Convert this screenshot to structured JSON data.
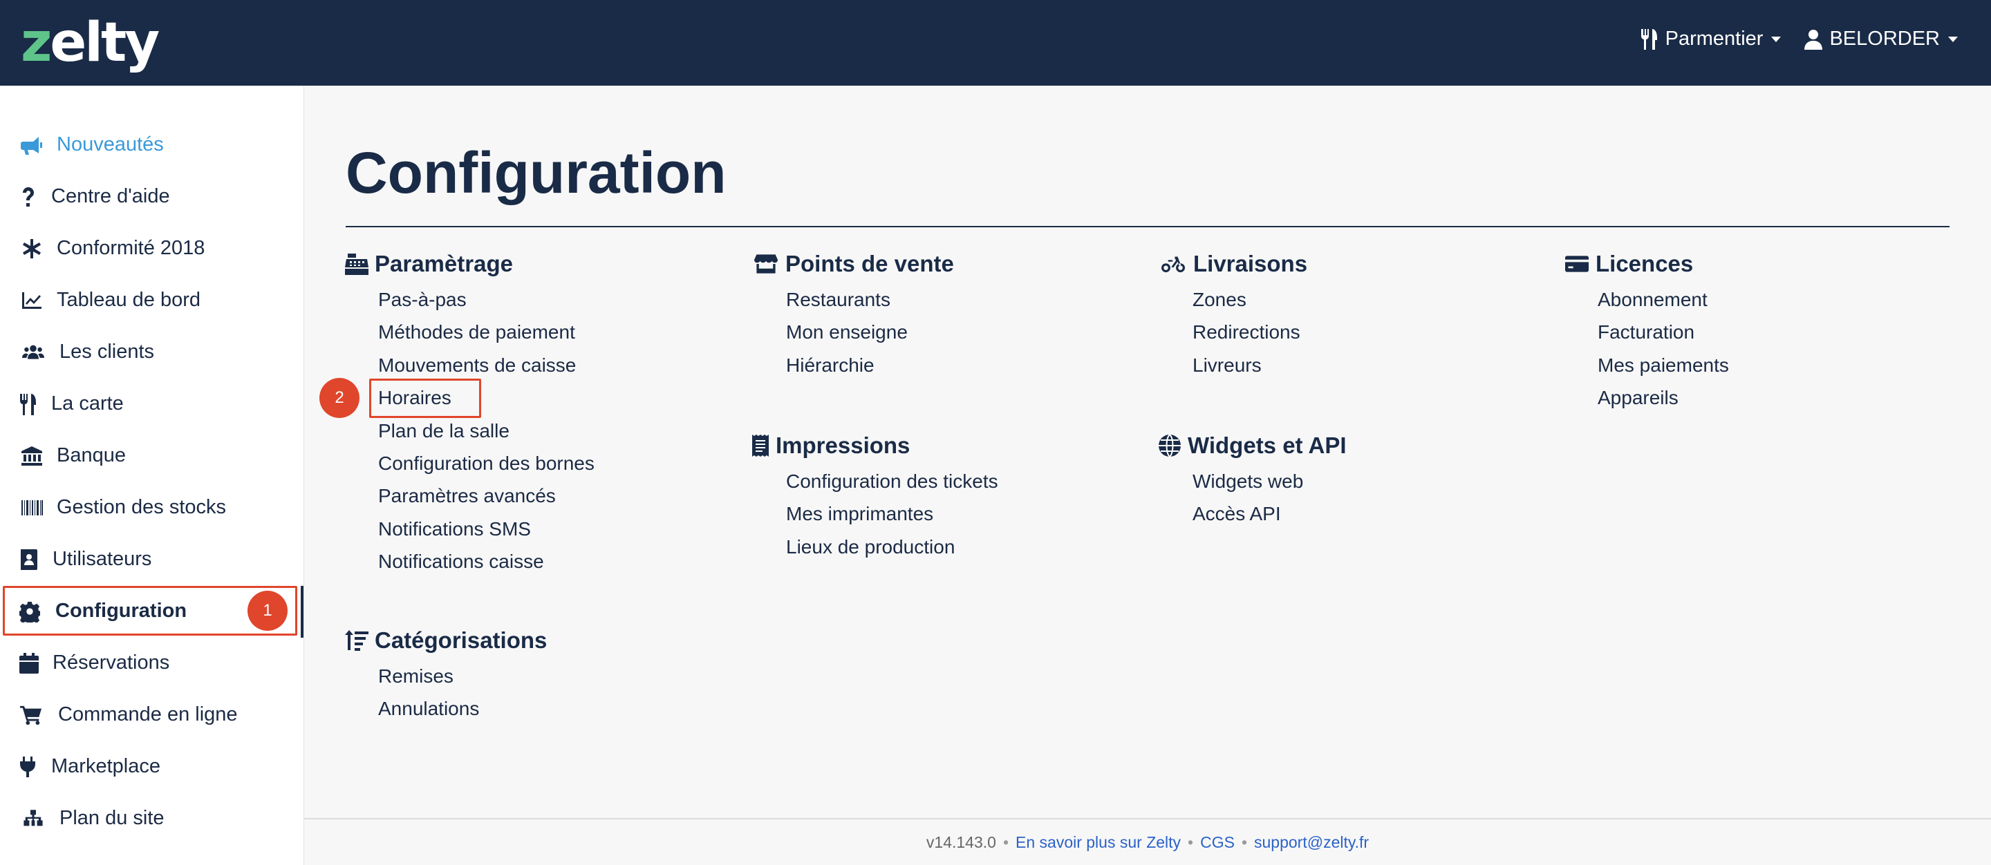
{
  "header": {
    "logo_z": "z",
    "logo_rest": "elty",
    "restaurant_label": "Parmentier",
    "user_label": "BELORDER"
  },
  "sidebar": {
    "items": [
      {
        "label": "Nouveautés",
        "icon": "megaphone-icon"
      },
      {
        "label": "Centre d'aide",
        "icon": "question-icon"
      },
      {
        "label": "Conformité 2018",
        "icon": "asterisk-icon"
      },
      {
        "label": "Tableau de bord",
        "icon": "line-chart-icon"
      },
      {
        "label": "Les clients",
        "icon": "users-icon"
      },
      {
        "label": "La carte",
        "icon": "utensils-icon"
      },
      {
        "label": "Banque",
        "icon": "bank-icon"
      },
      {
        "label": "Gestion des stocks",
        "icon": "barcode-icon"
      },
      {
        "label": "Utilisateurs",
        "icon": "address-book-icon"
      },
      {
        "label": "Configuration",
        "icon": "gear-icon"
      },
      {
        "label": "Réservations",
        "icon": "calendar-icon"
      },
      {
        "label": "Commande en ligne",
        "icon": "cart-icon"
      },
      {
        "label": "Marketplace",
        "icon": "plug-icon"
      },
      {
        "label": "Plan du site",
        "icon": "sitemap-icon"
      }
    ]
  },
  "annotations": {
    "step1": "1",
    "step2": "2"
  },
  "main": {
    "title": "Configuration",
    "sections": {
      "parametrage": {
        "title": "Paramètrage",
        "icon": "cash-register-icon",
        "links": [
          "Pas-à-pas",
          "Méthodes de paiement",
          "Mouvements de caisse",
          "Horaires",
          "Plan de la salle",
          "Configuration des bornes",
          "Paramètres avancés",
          "Notifications SMS",
          "Notifications caisse"
        ]
      },
      "points_de_vente": {
        "title": "Points de vente",
        "icon": "store-icon",
        "links": [
          "Restaurants",
          "Mon enseigne",
          "Hiérarchie"
        ]
      },
      "livraisons": {
        "title": "Livraisons",
        "icon": "bicycle-icon",
        "links": [
          "Zones",
          "Redirections",
          "Livreurs"
        ]
      },
      "licences": {
        "title": "Licences",
        "icon": "credit-card-icon",
        "links": [
          "Abonnement",
          "Facturation",
          "Mes paiements",
          "Appareils"
        ]
      },
      "impressions": {
        "title": "Impressions",
        "icon": "receipt-icon",
        "links": [
          "Configuration des tickets",
          "Mes imprimantes",
          "Lieux de production"
        ]
      },
      "widgets": {
        "title": "Widgets et API",
        "icon": "globe-icon",
        "links": [
          "Widgets web",
          "Accès API"
        ]
      },
      "categorisations": {
        "title": "Catégorisations",
        "icon": "sort-icon",
        "links": [
          "Remises",
          "Annulations"
        ]
      }
    }
  },
  "footer": {
    "version": "v14.143.0",
    "sep": "•",
    "about": "En savoir plus sur Zelty",
    "cgs": "CGS",
    "support": "support@zelty.fr"
  },
  "colors": {
    "header_bg": "#1a2b47",
    "accent_news": "#3a9ad9",
    "annotation": "#e0462b",
    "logo_green": "#5fc48a",
    "link_blue": "#2b62c8"
  }
}
